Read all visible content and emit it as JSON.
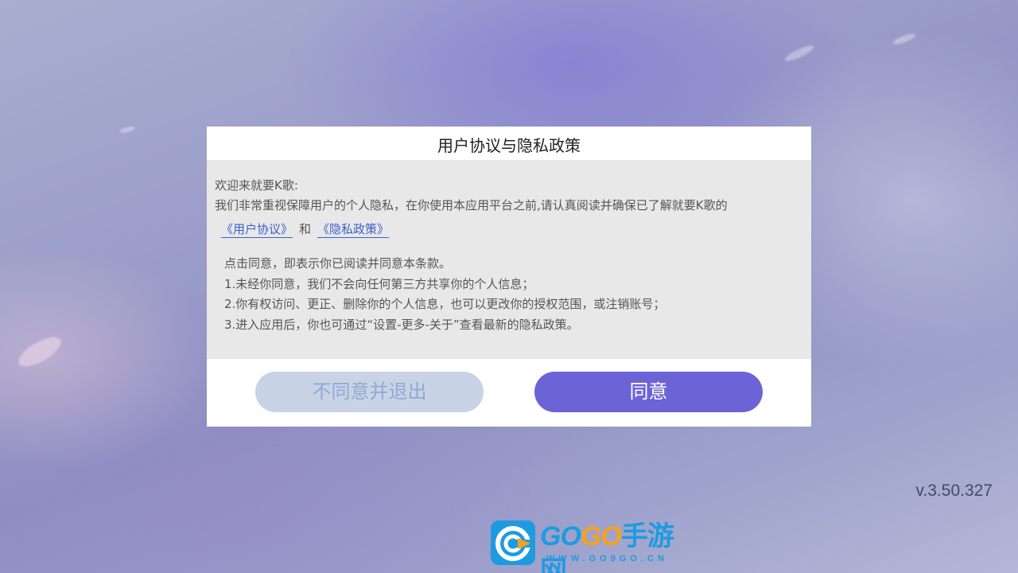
{
  "dialog": {
    "title": "用户协议与隐私政策",
    "welcome": "欢迎来就要K歌:",
    "intro": "我们非常重视保障用户的个人隐私，在你使用本应用平台之前,请认真阅读并确保已了解就要K歌的",
    "user_agreement_link": "《用户协议》",
    "and_text": "和",
    "privacy_policy_link": "《隐私政策》",
    "terms": [
      "点击同意，即表示你已阅读并同意本条款。",
      "1.未经你同意，我们不会向任何第三方共享你的个人信息；",
      "2.你有权访问、更正、删除你的个人信息，也可以更改你的授权范围，或注销账号；",
      "3.进入应用后，你也可通过“设置-更多-关于”查看最新的隐私政策。"
    ],
    "disagree_label": "不同意并退出",
    "agree_label": "同意"
  },
  "version": "v.3.50.327",
  "watermark": {
    "go1": "GO",
    "go2": "GO",
    "cn": "手游网",
    "url": "WWW.GO9GO.CN"
  },
  "colors": {
    "agree_button": "#6b63d6",
    "disagree_button": "#c8d3e6",
    "link": "#3f5fc8",
    "watermark_blue": "#1e9be0",
    "watermark_orange": "#f5a21c"
  }
}
